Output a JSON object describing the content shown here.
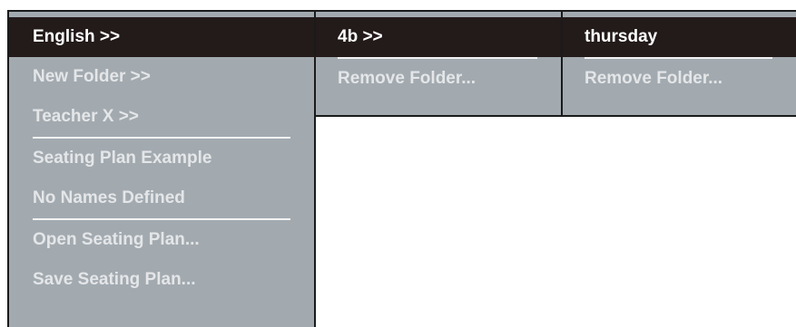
{
  "menus": {
    "main": {
      "items": [
        {
          "label": "English >>",
          "selected": true
        },
        {
          "label": "New Folder >>"
        },
        {
          "label": "Teacher X >>"
        },
        {
          "label": "Seating Plan Example"
        },
        {
          "label": "No Names Defined"
        },
        {
          "label": "Open Seating Plan..."
        },
        {
          "label": "Save Seating Plan..."
        }
      ]
    },
    "sub1": {
      "items": [
        {
          "label": "4b >>",
          "selected": true
        },
        {
          "label": "Remove Folder..."
        }
      ]
    },
    "sub2": {
      "items": [
        {
          "label": "thursday",
          "selected": true
        },
        {
          "label": "Remove Folder..."
        }
      ]
    }
  },
  "colors": {
    "menu_bg": "#a2aab0",
    "selected_bg": "#231a1a",
    "item_text": "#e4e6e8",
    "selected_text": "#ffffff",
    "border": "#1a1a1a"
  }
}
